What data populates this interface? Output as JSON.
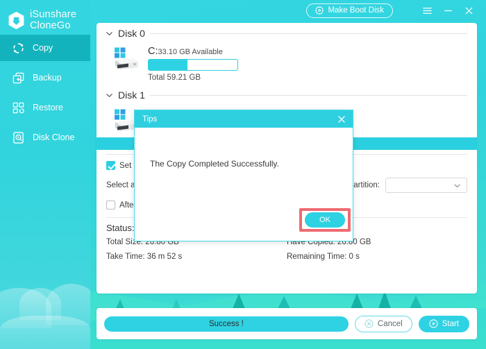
{
  "brand": {
    "line1": "iSunshare",
    "line2": "CloneGo",
    "logo_icon": "hexagon-download-icon"
  },
  "sidebar": {
    "items": [
      {
        "label": "Copy",
        "icon": "refresh-circular-icon",
        "active": true
      },
      {
        "label": "Backup",
        "icon": "backup-plus-square-icon",
        "active": false
      },
      {
        "label": "Restore",
        "icon": "restore-blocks-icon",
        "active": false
      },
      {
        "label": "Disk Clone",
        "icon": "disk-clone-icon",
        "active": false
      }
    ]
  },
  "topbar": {
    "make_boot_disk": "Make Boot Disk",
    "boot_icon": "disc-icon",
    "menu_icon": "hamburger-menu-icon",
    "minimize_icon": "minimize-icon",
    "close_icon": "close-icon"
  },
  "main": {
    "disk0": {
      "title": "Disk 0",
      "chevron_icon": "chevron-down-icon",
      "drive_icon": "windows-disk-icon",
      "drive_letter": "C:",
      "available": "33.10 GB Available",
      "total": "Total 59.21 GB",
      "used_percent": 44
    },
    "disk1": {
      "title": "Disk 1",
      "chevron_icon": "chevron-down-icon",
      "drive_icon": "windows-disk-icon"
    },
    "options": {
      "set_target_label": "Set t",
      "select_label": "Select a",
      "partition_label": "artition:",
      "partition_value": "",
      "partition_chevron_icon": "chevron-down-icon",
      "after_label": "After"
    },
    "status": {
      "heading": "Status:",
      "total_size": "Total Size: 26.80 GB",
      "have_copied": "Have Copied: 26.80 GB",
      "take_time": "Take Time: 36 m 52 s",
      "remaining_time": "Remaining Time: 0 s"
    }
  },
  "bottombar": {
    "progress_label": "Success !",
    "cancel_label": "Cancel",
    "cancel_icon": "cancel-circle-icon",
    "start_label": "Start",
    "start_icon": "play-circle-icon"
  },
  "dialog": {
    "title": "Tips",
    "close_icon": "close-icon",
    "message": "The Copy Completed Successfully.",
    "ok_label": "OK",
    "highlight_color": "#ef6b72"
  },
  "colors": {
    "accent": "#2fd2e2",
    "sidebar_active": "#13b3bd",
    "background": "#35d8e2",
    "highlight": "#ef6b72"
  }
}
